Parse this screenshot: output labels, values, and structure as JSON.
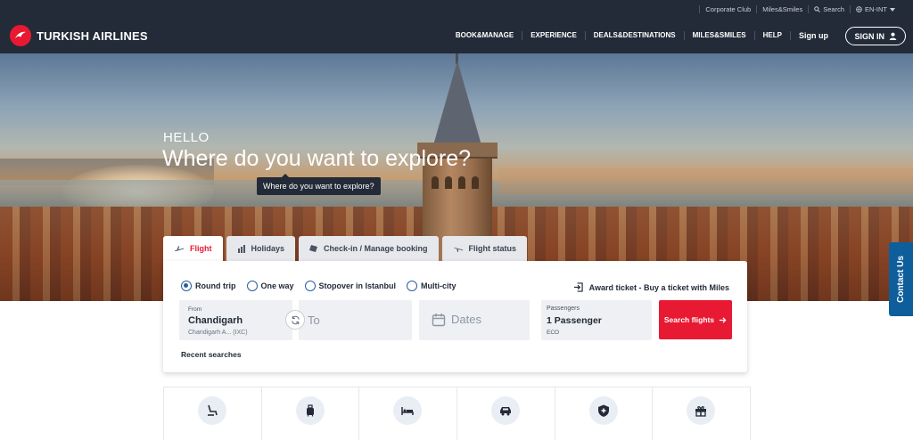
{
  "topbar": {
    "links": [
      "Corporate Club",
      "Miles&Smiles",
      "Search",
      "EN-INT"
    ]
  },
  "header": {
    "brand": "TURKISH AIRLINES",
    "nav": [
      "BOOK&MANAGE",
      "EXPERIENCE",
      "DEALS&DESTINATIONS",
      "MILES&SMILES",
      "HELP",
      "Sign up"
    ],
    "signin": "SIGN IN"
  },
  "hero": {
    "hello": "HELLO",
    "headline": "Where do you want to explore?",
    "tooltip": "Where do you want to explore?"
  },
  "tabs": [
    {
      "label": "Flight",
      "active": true
    },
    {
      "label": "Holidays"
    },
    {
      "label": "Check-in / Manage booking"
    },
    {
      "label": "Flight status"
    }
  ],
  "booking": {
    "trip_types": [
      {
        "label": "Round trip",
        "selected": true
      },
      {
        "label": "One way"
      },
      {
        "label": "Stopover in Istanbul"
      },
      {
        "label": "Multi-city"
      }
    ],
    "award": "Award ticket - Buy a ticket with Miles",
    "from_label": "From",
    "from_city": "Chandigarh",
    "from_sub": "Chandigarh A... (IXC)",
    "to_placeholder": "To",
    "dates_placeholder": "Dates",
    "passengers_label": "Passengers",
    "passengers_value": "1 Passenger",
    "cabin": "ECO",
    "search": "Search flights",
    "recent": "Recent searches"
  },
  "contact": "Contact Us",
  "services": {
    "icons": [
      "seat-icon",
      "baggage-icon",
      "hotel-icon",
      "car-icon",
      "insurance-icon",
      "gift-icon"
    ],
    "captions": [
      "",
      "",
      "",
      "",
      "",
      ""
    ]
  },
  "colors": {
    "brand_red": "#e81932",
    "header_bg": "#232b38",
    "contact_blue": "#0f5e9c",
    "radio_blue": "#2b5e9e"
  }
}
